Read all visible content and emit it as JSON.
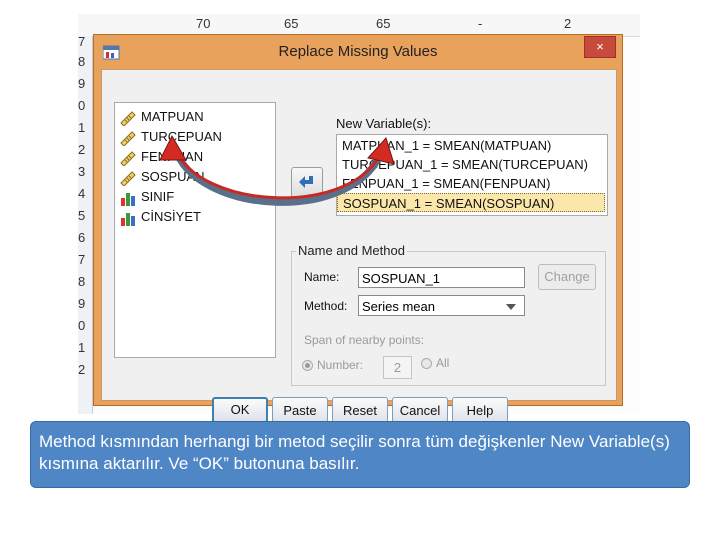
{
  "spreadsheet": {
    "top_values": [
      "70",
      "65",
      "65",
      "-",
      "2"
    ],
    "row_digits": [
      "7",
      "8",
      "9",
      "0",
      "1",
      "2",
      "3",
      "4",
      "5",
      "6",
      "7",
      "8",
      "9",
      "0",
      "1",
      "2"
    ]
  },
  "dialog": {
    "title": "Replace Missing Values",
    "close_label": "×",
    "source_variables": [
      {
        "label": "MATPUAN",
        "icon": "scale-ruler-icon"
      },
      {
        "label": "TURCEPUAN",
        "icon": "scale-ruler-icon"
      },
      {
        "label": "FENPUAN",
        "icon": "scale-ruler-icon"
      },
      {
        "label": "SOSPUAN",
        "icon": "scale-ruler-icon"
      },
      {
        "label": "SINIF",
        "icon": "bar-chart-icon"
      },
      {
        "label": "CİNSİYET",
        "icon": "bar-chart-icon"
      }
    ],
    "new_variables_label": "New Variable(s):",
    "new_variables": [
      "MATPUAN_1 = SMEAN(MATPUAN)",
      "TURCEPUAN_1 = SMEAN(TURCEPUAN)",
      "FENPUAN_1 = SMEAN(FENPUAN)",
      "SOSPUAN_1 = SMEAN(SOSPUAN)"
    ],
    "name_method": {
      "group_title": "Name and Method",
      "name_label": "Name:",
      "name_value": "SOSPUAN_1",
      "change_label": "Change",
      "method_label": "Method:",
      "method_value": "Series mean",
      "span_label": "Span of nearby points:",
      "number_label": "Number:",
      "number_value": "2",
      "all_label": "All"
    },
    "buttons": {
      "ok": "OK",
      "paste": "Paste",
      "reset": "Reset",
      "cancel": "Cancel",
      "help": "Help"
    }
  },
  "caption": {
    "text": "Method kısmından herhangi bir metod seçilir sonra tüm değişkenler New Variable(s) kısmına aktarılır. Ve “OK” butonuna basılır."
  },
  "colors": {
    "dialog_frame": "#e8a25c",
    "close_button": "#c74a3d",
    "selected_row": "#fbe7a9",
    "arrow_curve": "#5a6f8a",
    "arrow_head": "#d42a22",
    "caption_bg": "#4f86c6"
  }
}
